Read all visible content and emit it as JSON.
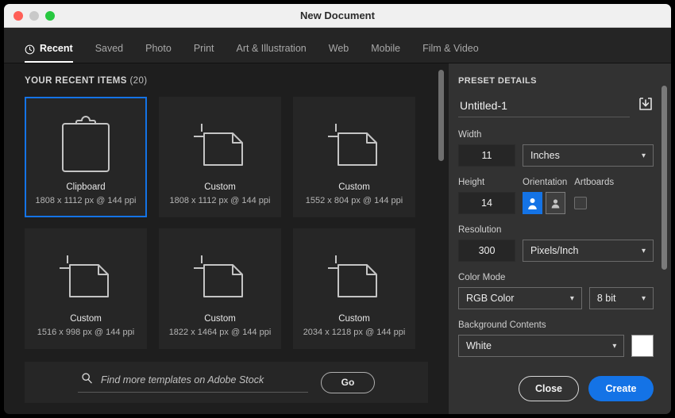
{
  "window": {
    "title": "New Document",
    "traffic_lights": [
      "close-red",
      "minimize-gray",
      "maximize-green"
    ]
  },
  "tabs": [
    {
      "label": "Recent",
      "icon": "clock-icon",
      "active": true
    },
    {
      "label": "Saved",
      "active": false
    },
    {
      "label": "Photo",
      "active": false
    },
    {
      "label": "Print",
      "active": false
    },
    {
      "label": "Art & Illustration",
      "active": false
    },
    {
      "label": "Web",
      "active": false
    },
    {
      "label": "Mobile",
      "active": false
    },
    {
      "label": "Film & Video",
      "active": false
    }
  ],
  "recent": {
    "heading": "YOUR RECENT ITEMS",
    "count": "(20)",
    "items": [
      {
        "name": "Clipboard",
        "dims": "1808 x 1112 px @ 144 ppi",
        "icon": "clipboard-icon",
        "selected": true
      },
      {
        "name": "Custom",
        "dims": "1808 x 1112 px @ 144 ppi",
        "icon": "document-icon",
        "selected": false
      },
      {
        "name": "Custom",
        "dims": "1552 x 804 px @ 144 ppi",
        "icon": "document-icon",
        "selected": false
      },
      {
        "name": "Custom",
        "dims": "1516 x 998 px @ 144 ppi",
        "icon": "document-icon",
        "selected": false
      },
      {
        "name": "Custom",
        "dims": "1822 x 1464 px @ 144 ppi",
        "icon": "document-icon",
        "selected": false
      },
      {
        "name": "Custom",
        "dims": "2034 x 1218 px @ 144 ppi",
        "icon": "document-icon",
        "selected": false
      }
    ]
  },
  "stock": {
    "placeholder": "Find more templates on Adobe Stock",
    "value": "",
    "go_label": "Go",
    "search_icon": "search-icon"
  },
  "preset": {
    "heading": "PRESET DETAILS",
    "name_value": "Untitled-1",
    "save_icon": "save-preset-icon",
    "width_label": "Width",
    "width_value": "11",
    "width_unit": "Inches",
    "height_label": "Height",
    "height_value": "14",
    "orientation_label": "Orientation",
    "orientation_selected": "portrait",
    "artboards_label": "Artboards",
    "artboards_checked": false,
    "resolution_label": "Resolution",
    "resolution_value": "300",
    "resolution_unit": "Pixels/Inch",
    "color_mode_label": "Color Mode",
    "color_mode_value": "RGB Color",
    "bit_depth_value": "8 bit",
    "background_label": "Background Contents",
    "background_value": "White",
    "background_swatch": "#ffffff"
  },
  "footer": {
    "close_label": "Close",
    "create_label": "Create"
  },
  "colors": {
    "accent": "#1473e6",
    "left_panel_bg": "#1e1e1e",
    "right_panel_bg": "#323232",
    "titlebar_bg": "#f0f0f0"
  }
}
